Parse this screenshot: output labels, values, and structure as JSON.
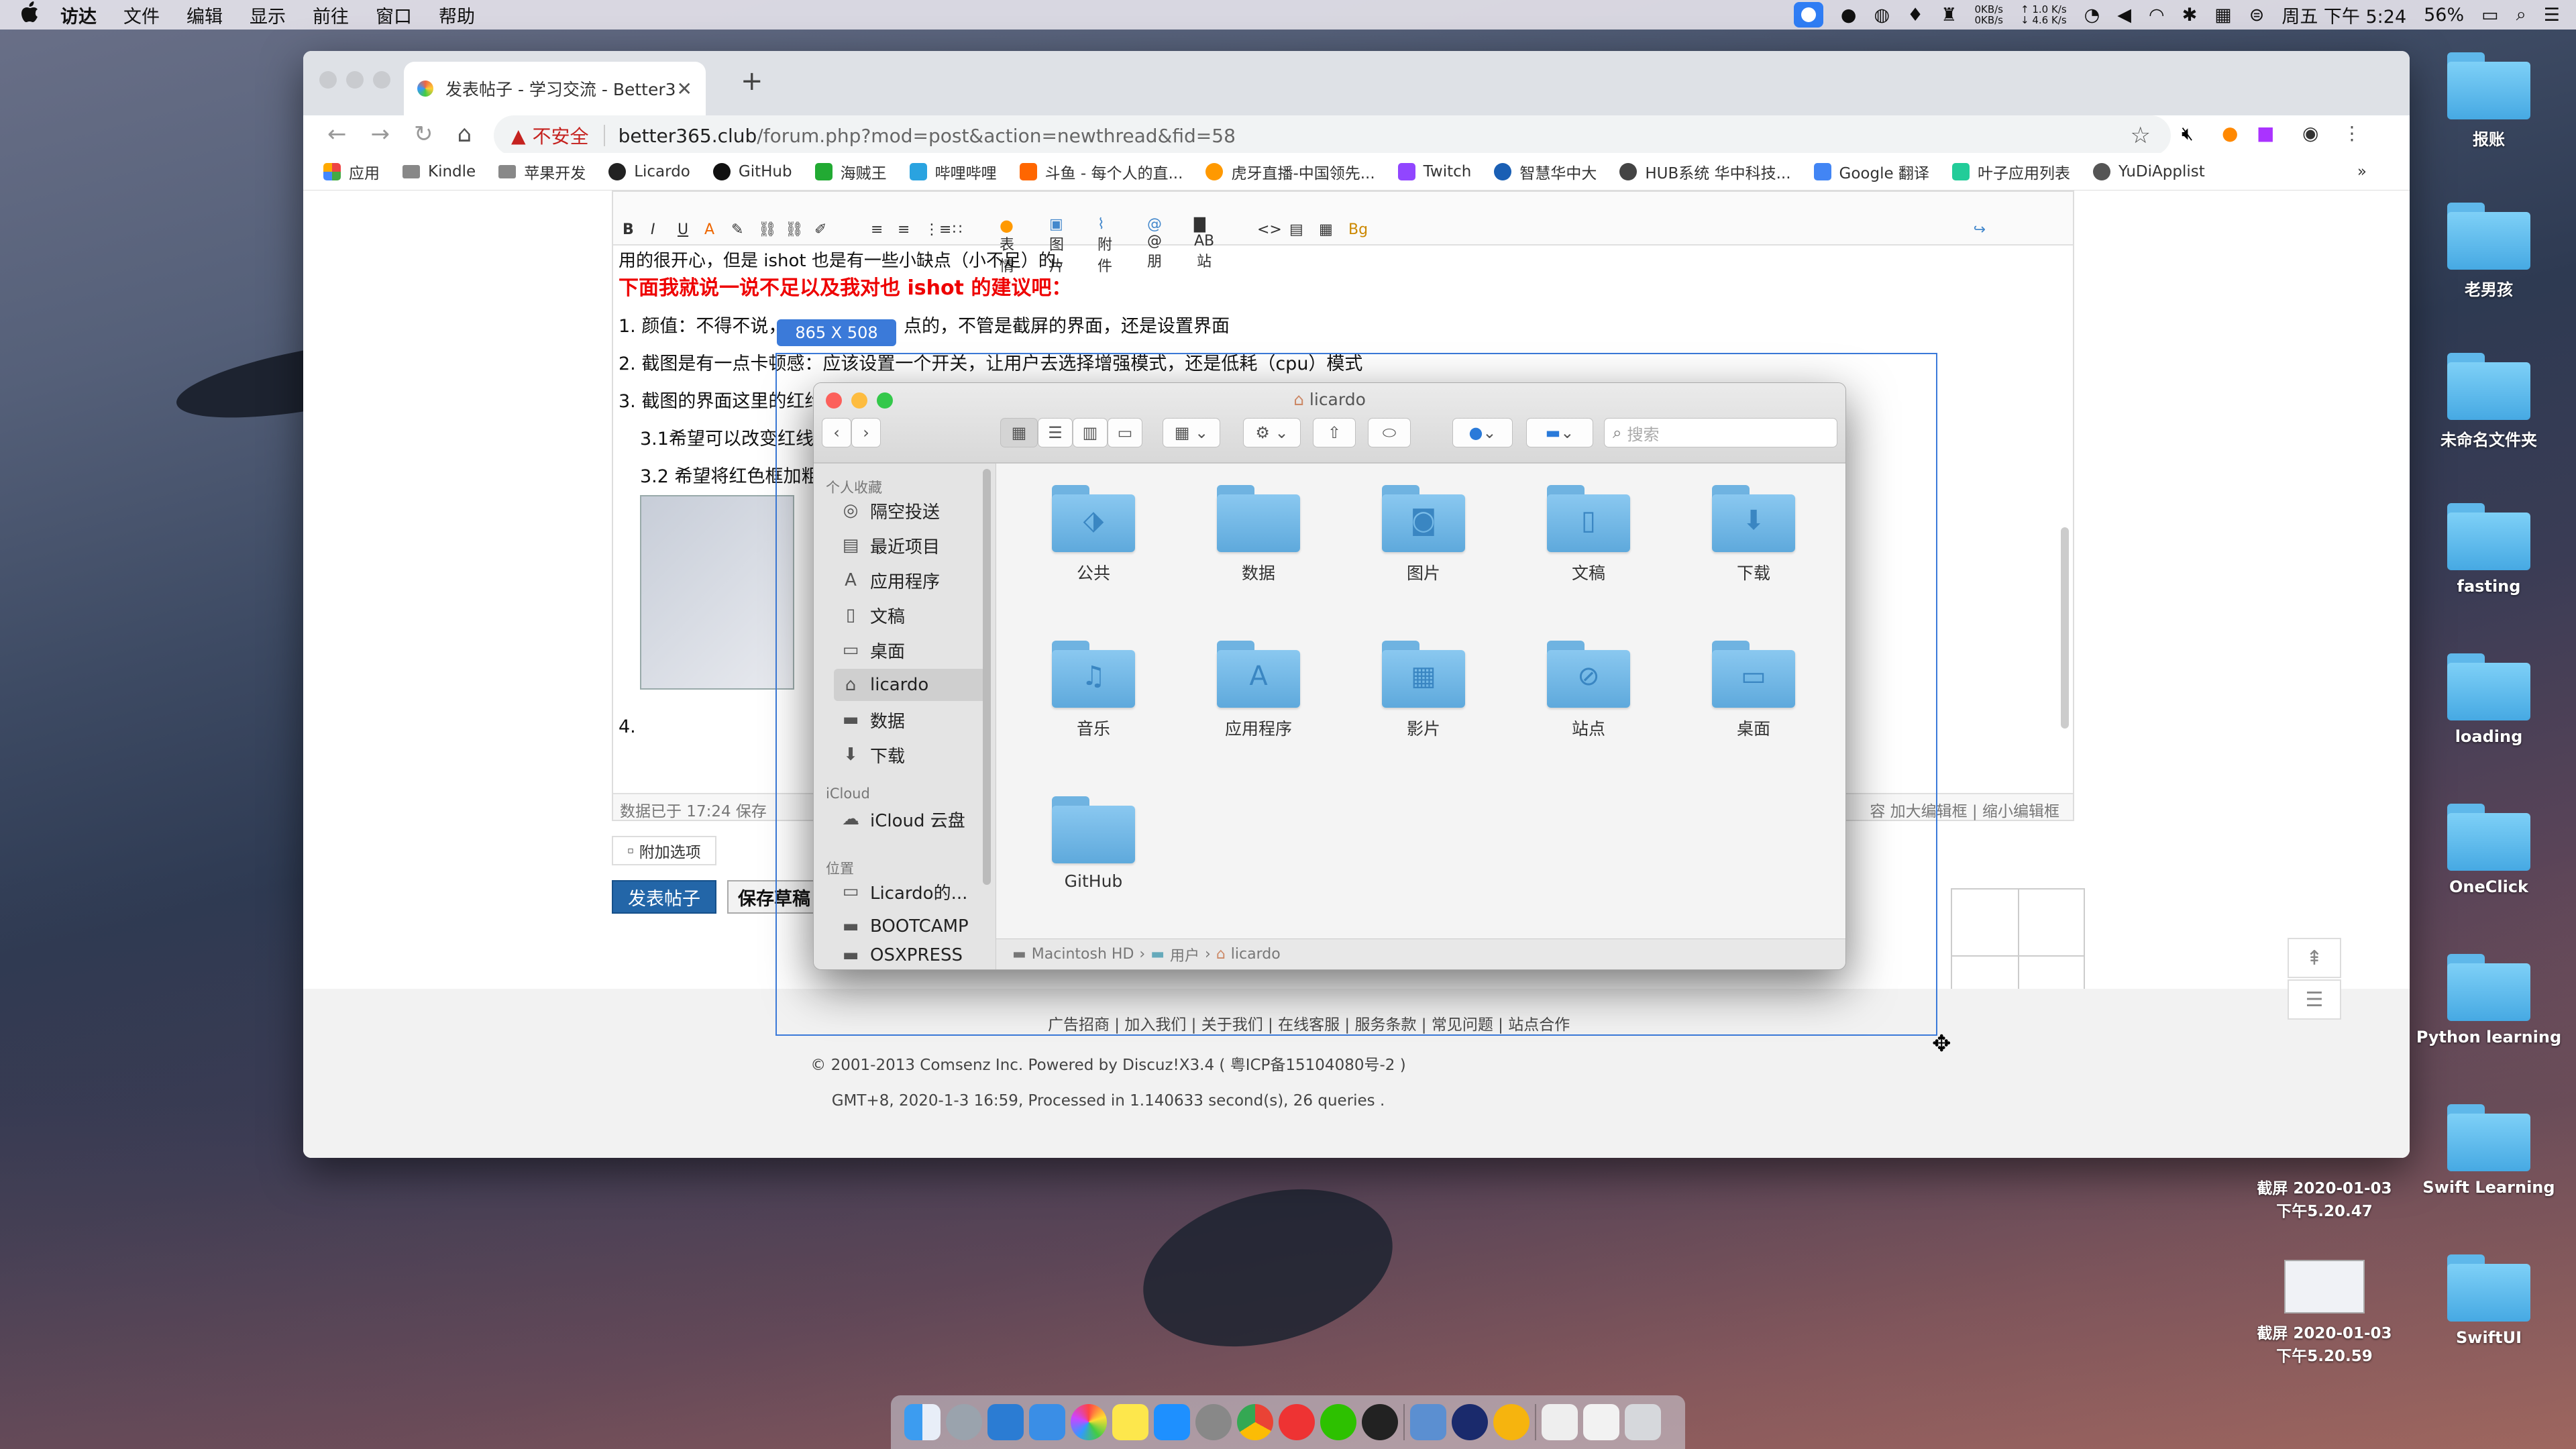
{
  "menubar": {
    "apple": "",
    "items": [
      "访达",
      "文件",
      "编辑",
      "显示",
      "前往",
      "窗口",
      "帮助"
    ],
    "net_down": "0KB/s",
    "net_up": "0KB/s",
    "net_up2": "↑ 1.0 K/s",
    "net_down2": "↓ 4.6 K/s",
    "clock": "周五 下午 5:24",
    "battery": "56%"
  },
  "browser": {
    "tab_title": "发表帖子 - 学习交流 - Better365",
    "insecure_label": "不安全",
    "url_host": "better365.club",
    "url_path": "/forum.php?mod=post&action=newthread&fid=58",
    "bookmarks": [
      "应用",
      "Kindle",
      "苹果开发",
      "Licardo",
      "GitHub",
      "海贼王",
      "哔哩哔哩",
      "斗鱼 - 每个人的直...",
      "虎牙直播-中国领先...",
      "Twitch",
      "智慧华中大",
      "HUB系统 华中科技...",
      "Google 翻译",
      "叶子应用列表",
      "YuDiApplist"
    ],
    "bookmarks_more": "»"
  },
  "editor": {
    "toolbar_labels": [
      "表情",
      "图片",
      "附件",
      "@朋",
      "AB站"
    ],
    "line_top": "用的很开心，但是 ishot 也是有一些小缺点（小不足）的。",
    "heading": "下面我就说一说不足以及我对也 ishot 的建议吧：",
    "line1": "1. 颜值：不得不说，",
    "line1b": "点的，不管是截屏的界面，还是设置界面",
    "line2": "2. 截图是有一点卡顿感：应该设置一个开关，让用户去选择增强模式，还是低耗（cpu）模式",
    "line3": "3. 截图的界面这里的红约",
    "line31": "3.1希望可以改变红线",
    "line32": "3.2 希望将红色框加粗",
    "line4": "4.",
    "saved": "数据已于 17:24 保存",
    "bottom_right": "容    加大编辑框 | 缩小编辑框"
  },
  "form": {
    "add_option": "附加选项",
    "post_button": "发表帖子",
    "save_button": "保存草稿"
  },
  "footer": {
    "links": "广告招商 |  加入我们 |  关于我们 |  在线客服 |  服务条款 |  常见问题 |  站点合作",
    "copyright": "© 2001-2013 Comsenz Inc. Powered by Discuz!X3.4 ( 粤ICP备15104080号-2 )",
    "processed": "GMT+8, 2020-1-3 16:59, Processed in 1.140633 second(s), 26 queries ."
  },
  "screenshot_tool": {
    "dimensions": "865  X  508"
  },
  "finder": {
    "title": "licardo",
    "search_placeholder": "搜索",
    "sidebar": {
      "favorites_header": "个人收藏",
      "favorites": [
        {
          "label": "隔空投送",
          "icon": "airdrop-icon"
        },
        {
          "label": "最近项目",
          "icon": "clock-icon"
        },
        {
          "label": "应用程序",
          "icon": "apps-icon"
        },
        {
          "label": "文稿",
          "icon": "doc-icon"
        },
        {
          "label": "桌面",
          "icon": "desktop-icon"
        },
        {
          "label": "licardo",
          "icon": "home-icon"
        },
        {
          "label": "数据",
          "icon": "folder-icon"
        },
        {
          "label": "下载",
          "icon": "download-icon"
        }
      ],
      "icloud_header": "iCloud",
      "icloud": [
        {
          "label": "iCloud 云盘",
          "icon": "cloud-icon"
        }
      ],
      "locations_header": "位置",
      "locations": [
        {
          "label": "Licardo的...",
          "icon": "computer-icon"
        },
        {
          "label": "BOOTCAMP",
          "icon": "disk-icon"
        },
        {
          "label": "OSXPRESS",
          "icon": "disk-icon"
        }
      ]
    },
    "items": [
      {
        "label": "公共",
        "glyph": "⬗"
      },
      {
        "label": "数据",
        "glyph": ""
      },
      {
        "label": "图片",
        "glyph": "◙"
      },
      {
        "label": "文稿",
        "glyph": "▯"
      },
      {
        "label": "下载",
        "glyph": "⬇"
      },
      {
        "label": "音乐",
        "glyph": "♫"
      },
      {
        "label": "应用程序",
        "glyph": "A"
      },
      {
        "label": "影片",
        "glyph": "▦"
      },
      {
        "label": "站点",
        "glyph": "⊘"
      },
      {
        "label": "桌面",
        "glyph": "▭"
      },
      {
        "label": "GitHub",
        "glyph": ""
      }
    ],
    "path": [
      "Macintosh HD",
      "用户",
      "licardo"
    ]
  },
  "desktop": {
    "icons": [
      "报账",
      "老男孩",
      "未命名文件夹",
      "fasting",
      "loading",
      "OneClick",
      "Python learning",
      "Swift Learning",
      "SwiftUI"
    ],
    "screenshots": [
      "截屏 2020-01-03 下午5.20.47",
      "截屏 2020-01-03 下午5.20.59"
    ]
  }
}
